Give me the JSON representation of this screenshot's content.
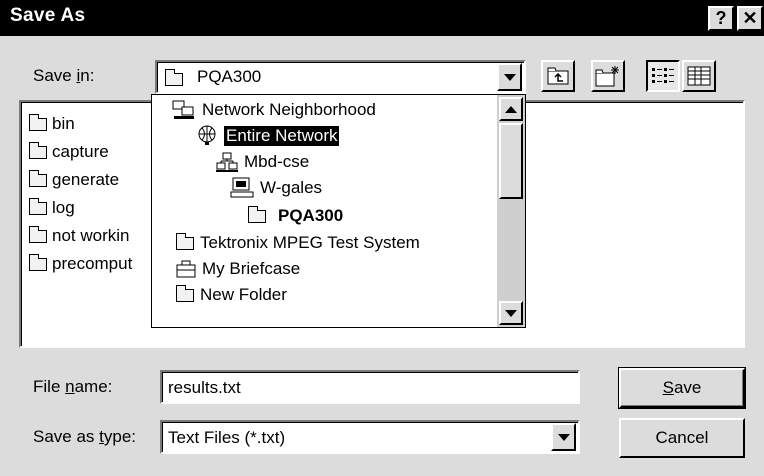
{
  "window": {
    "title": "Save As",
    "help_button": "?",
    "close_button": "✕"
  },
  "save_in": {
    "label_pre": "Save ",
    "label_key": "i",
    "label_post": "n:",
    "value": "PQA300"
  },
  "file_list": [
    "bin",
    "capture",
    "generate",
    "log",
    "not workin",
    "precomput"
  ],
  "location_dropdown": {
    "items": [
      {
        "label": "Network Neighborhood",
        "icon": "network-neighborhood-icon",
        "selected": false
      },
      {
        "label": "Entire Network",
        "icon": "globe-icon",
        "selected": true
      },
      {
        "label": "Mbd-cse",
        "icon": "workgroup-icon",
        "selected": false
      },
      {
        "label": "W-gales",
        "icon": "computer-icon",
        "selected": false
      },
      {
        "label": "PQA300",
        "icon": "folder-icon",
        "selected": false
      },
      {
        "label": "Tektronix MPEG Test System",
        "icon": "folder-icon",
        "selected": false
      },
      {
        "label": "My Briefcase",
        "icon": "briefcase-icon",
        "selected": false
      },
      {
        "label": "New Folder",
        "icon": "folder-icon",
        "selected": false
      }
    ]
  },
  "file_name": {
    "label_pre": "File ",
    "label_key": "n",
    "label_post": "ame:",
    "value": "results.txt"
  },
  "save_as_type": {
    "label_pre": "Save as ",
    "label_key": "t",
    "label_post": "ype:",
    "value": "Text Files (*.txt)"
  },
  "buttons": {
    "save_key": "S",
    "save_rest": "ave",
    "cancel": "Cancel"
  }
}
